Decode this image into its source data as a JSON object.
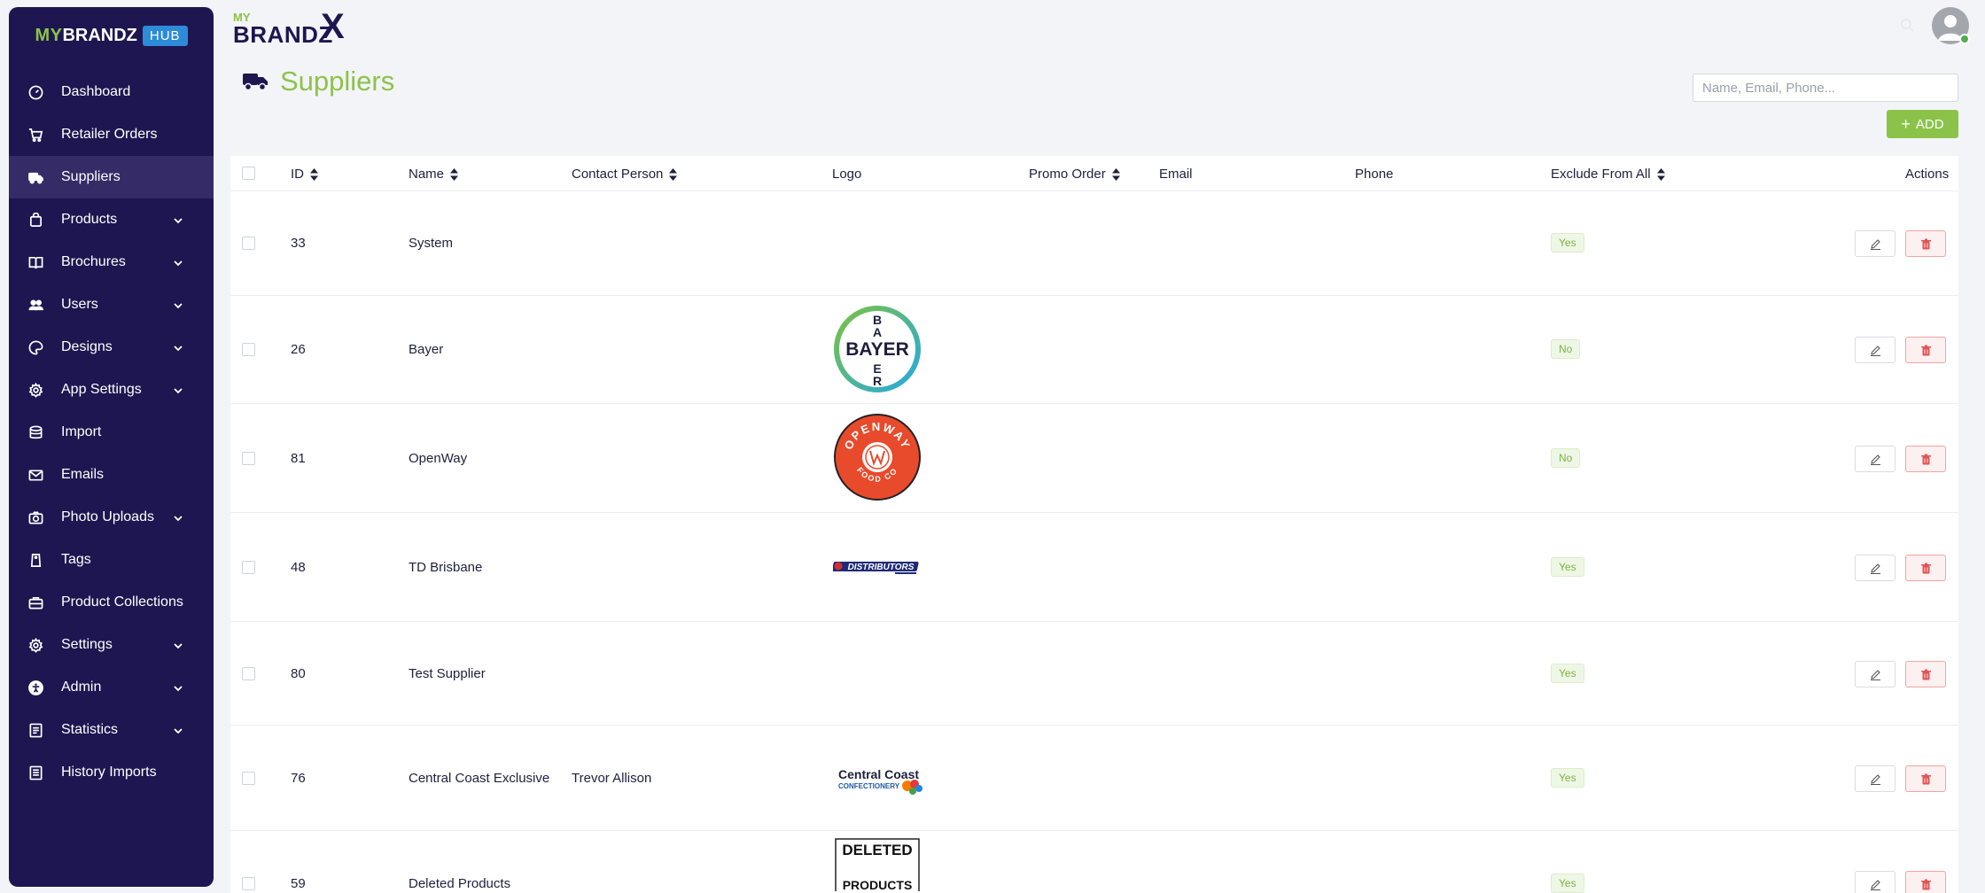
{
  "sidebar": {
    "brand": {
      "my": "MY",
      "name": "BRANDZ",
      "hub": "HUB"
    },
    "items": [
      {
        "label": "Dashboard",
        "icon": "dashboard-icon",
        "expandable": false,
        "active": false
      },
      {
        "label": "Retailer Orders",
        "icon": "cart-icon",
        "expandable": false,
        "active": false
      },
      {
        "label": "Suppliers",
        "icon": "truck-icon",
        "expandable": false,
        "active": true
      },
      {
        "label": "Products",
        "icon": "bag-icon",
        "expandable": true,
        "active": false
      },
      {
        "label": "Brochures",
        "icon": "book-icon",
        "expandable": true,
        "active": false
      },
      {
        "label": "Users",
        "icon": "users-icon",
        "expandable": true,
        "active": false
      },
      {
        "label": "Designs",
        "icon": "palette-icon",
        "expandable": true,
        "active": false
      },
      {
        "label": "App Settings",
        "icon": "gear-icon",
        "expandable": true,
        "active": false
      },
      {
        "label": "Import",
        "icon": "database-icon",
        "expandable": false,
        "active": false
      },
      {
        "label": "Emails",
        "icon": "envelope-icon",
        "expandable": false,
        "active": false
      },
      {
        "label": "Photo Uploads",
        "icon": "camera-icon",
        "expandable": true,
        "active": false
      },
      {
        "label": "Tags",
        "icon": "tag-icon",
        "expandable": false,
        "active": false
      },
      {
        "label": "Product Collections",
        "icon": "briefcase-icon",
        "expandable": false,
        "active": false
      },
      {
        "label": "Settings",
        "icon": "gear-icon",
        "expandable": true,
        "active": false
      },
      {
        "label": "Admin",
        "icon": "accessibility-icon",
        "expandable": true,
        "active": false
      },
      {
        "label": "Statistics",
        "icon": "report-icon",
        "expandable": true,
        "active": false
      },
      {
        "label": "History Imports",
        "icon": "document-list-icon",
        "expandable": false,
        "active": false
      }
    ]
  },
  "header": {
    "logo": {
      "my": "MY",
      "brandz": "BRANDZ",
      "x": "X"
    }
  },
  "page": {
    "title": "Suppliers",
    "search_placeholder": "Name, Email, Phone...",
    "add_label": "ADD"
  },
  "table": {
    "columns": {
      "id": "ID",
      "name": "Name",
      "contact": "Contact Person",
      "logo": "Logo",
      "promo": "Promo Order",
      "email": "Email",
      "phone": "Phone",
      "exclude": "Exclude From All",
      "actions": "Actions"
    },
    "rows": [
      {
        "id": "33",
        "name": "System",
        "contact": "",
        "logo": "",
        "promo": "",
        "email": "",
        "phone": "",
        "exclude": "Yes"
      },
      {
        "id": "26",
        "name": "Bayer",
        "contact": "",
        "logo": "bayer",
        "promo": "",
        "email": "",
        "phone": "",
        "exclude": "No"
      },
      {
        "id": "81",
        "name": "OpenWay",
        "contact": "",
        "logo": "openway",
        "promo": "",
        "email": "",
        "phone": "",
        "exclude": "No"
      },
      {
        "id": "48",
        "name": "TD Brisbane",
        "contact": "",
        "logo": "distributors",
        "promo": "",
        "email": "",
        "phone": "",
        "exclude": "Yes"
      },
      {
        "id": "80",
        "name": "Test Supplier",
        "contact": "",
        "logo": "",
        "promo": "",
        "email": "",
        "phone": "",
        "exclude": "Yes"
      },
      {
        "id": "76",
        "name": "Central Coast Exclusive",
        "contact": "Trevor Allison",
        "logo": "centralcoast",
        "promo": "",
        "email": "",
        "phone": "",
        "exclude": "Yes"
      },
      {
        "id": "59",
        "name": "Deleted Products",
        "contact": "",
        "logo": "deleted",
        "promo": "",
        "email": "",
        "phone": "",
        "exclude": "Yes"
      }
    ],
    "logo_text": {
      "bayer": "BAYER",
      "openway_top": "OPENWAY",
      "openway_bottom": "FOOD CO",
      "distributors": "DISTRIBUTORS",
      "centralcoast_1": "Central Coast",
      "centralcoast_2": "CONFECTIONERY",
      "deleted_1": "DELETED",
      "deleted_2": "PRODUCTS"
    }
  },
  "colors": {
    "sidebar_bg": "#1e1650",
    "accent_green": "#8bc34a",
    "hub_blue": "#2d8bd8",
    "delete_red": "#e05555"
  }
}
